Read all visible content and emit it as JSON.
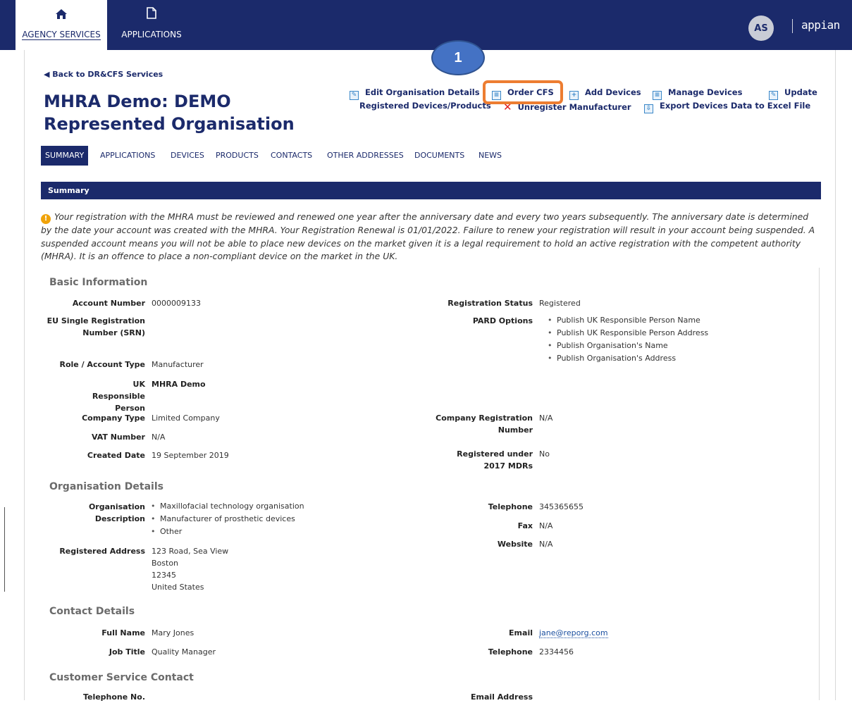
{
  "nav": {
    "agency": "AGENCY SERVICES",
    "applications": "APPLICATIONS",
    "avatar": "AS",
    "logo": "appian"
  },
  "header": {
    "back": "◀ Back to DR&CFS Services",
    "title": "MHRA Demo: DEMO Represented Organisation"
  },
  "actions": {
    "edit_org": "Edit Organisation Details",
    "order_cfs": "Order CFS",
    "add_devices": "Add Devices",
    "manage_devices": "Manage Devices",
    "update": "Update",
    "registered_devices": "Registered Devices/Products",
    "unregister": "Unregister Manufacturer",
    "export": "Export Devices Data to Excel File"
  },
  "callout": {
    "number": "1"
  },
  "tabs": [
    "SUMMARY",
    "APPLICATIONS",
    "DEVICES",
    "PRODUCTS",
    "CONTACTS",
    "OTHER ADDRESSES",
    "DOCUMENTS",
    "NEWS"
  ],
  "summary": {
    "bar": "Summary",
    "notice": "Your registration with the MHRA must be reviewed and renewed one year after the anniversary date and every two years subsequently. The anniversary date is determined by the date your account was created with the MHRA. Your Registration Renewal is 01/01/2022. Failure to renew your registration will result in your account being suspended. A suspended account means you will not be able to place new devices on the market given it is a legal requirement to hold an active registration with the competent authority (MHRA). It is an offence to place a non-compliant device on the market in the UK."
  },
  "basic": {
    "heading": "Basic Information",
    "account_number_label": "Account Number",
    "account_number": "0000009133",
    "srn_label": "EU Single Registration Number (SRN)",
    "role_label": "Role / Account Type",
    "role": "Manufacturer",
    "ukrp_label": "UK Responsible Person",
    "ukrp": "MHRA Demo",
    "company_type_label": "Company Type",
    "company_type": "Limited Company",
    "vat_label": "VAT Number",
    "vat": "N/A",
    "created_label": "Created Date",
    "created": "19 September 2019",
    "reg_status_label": "Registration Status",
    "reg_status": "Registered",
    "pard_label": "PARD Options",
    "pard": [
      "Publish UK Responsible Person Name",
      "Publish UK Responsible Person Address",
      "Publish Organisation's Name",
      "Publish Organisation's Address"
    ],
    "company_reg_label": "Company Registration Number",
    "company_reg": "N/A",
    "mdr_label": "Registered under 2017 MDRs",
    "mdr": "No"
  },
  "org": {
    "heading": "Organisation Details",
    "desc_label": "Organisation Description",
    "desc": [
      "Maxillofacial technology organisation",
      "Manufacturer of prosthetic devices",
      "Other"
    ],
    "address_label": "Registered Address",
    "address": [
      "123 Road, Sea View",
      "Boston",
      "12345",
      "United States"
    ],
    "telephone_label": "Telephone",
    "telephone": "345365655",
    "fax_label": "Fax",
    "fax": "N/A",
    "website_label": "Website",
    "website": "N/A"
  },
  "contact": {
    "heading": "Contact Details",
    "name_label": "Full Name",
    "name": "Mary Jones",
    "job_label": "Job Title",
    "job": "Quality Manager",
    "email_label": "Email",
    "email": "jane@reporg.com",
    "phone_label": "Telephone",
    "phone": "2334456"
  },
  "customer": {
    "heading": "Customer Service Contact",
    "phone_label": "Telephone No.",
    "email_label": "Email Address"
  }
}
